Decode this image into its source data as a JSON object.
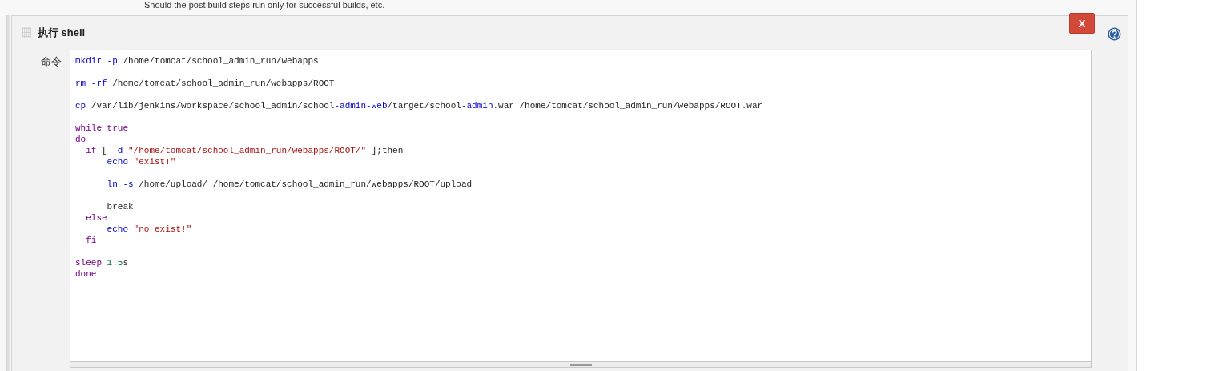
{
  "top_description": "Should the post build steps run only for successful builds, etc.",
  "section": {
    "title": "执行 shell",
    "delete_label": "X",
    "field_label": "命令",
    "code_lines": [
      {
        "kind": "code",
        "tokens": [
          {
            "text": "mkdir",
            "kind": "builtin"
          },
          {
            "text": " -p",
            "kind": "builtin"
          },
          {
            "text": " /home/tomcat/school_admin_run/webapps",
            "kind": "plain"
          }
        ]
      },
      {
        "kind": "blank"
      },
      {
        "kind": "code",
        "tokens": [
          {
            "text": "rm",
            "kind": "builtin"
          },
          {
            "text": " -rf",
            "kind": "builtin"
          },
          {
            "text": " /home/tomcat/school_admin_run/webapps/ROOT",
            "kind": "plain"
          }
        ]
      },
      {
        "kind": "blank"
      },
      {
        "kind": "code",
        "tokens": [
          {
            "text": "cp",
            "kind": "builtin"
          },
          {
            "text": " /var/lib/jenkins/workspace/school_admin/school",
            "kind": "plain"
          },
          {
            "text": "-admin-web",
            "kind": "builtin"
          },
          {
            "text": "/target/school",
            "kind": "plain"
          },
          {
            "text": "-admin",
            "kind": "builtin"
          },
          {
            "text": ".war /home/tomcat/school_admin_run/webapps/ROOT.war",
            "kind": "plain"
          }
        ]
      },
      {
        "kind": "blank"
      },
      {
        "kind": "code",
        "tokens": [
          {
            "text": "while",
            "kind": "keyword"
          },
          {
            "text": " true",
            "kind": "keyword"
          }
        ]
      },
      {
        "kind": "code",
        "tokens": [
          {
            "text": "do",
            "kind": "keyword"
          }
        ]
      },
      {
        "kind": "code",
        "tokens": [
          {
            "text": "  if",
            "kind": "keyword"
          },
          {
            "text": " [",
            "kind": "plain"
          },
          {
            "text": " -d",
            "kind": "builtin"
          },
          {
            "text": " \"/home/tomcat/school_admin_run/webapps/ROOT/\"",
            "kind": "string"
          },
          {
            "text": " ];then",
            "kind": "plain"
          }
        ]
      },
      {
        "kind": "code",
        "tokens": [
          {
            "text": "      echo",
            "kind": "builtin"
          },
          {
            "text": " \"exist!\"",
            "kind": "string"
          }
        ]
      },
      {
        "kind": "blank"
      },
      {
        "kind": "code",
        "tokens": [
          {
            "text": "      ln -s",
            "kind": "builtin"
          },
          {
            "text": " /home/upload/ /home/tomcat/school_admin_run/webapps/ROOT/upload",
            "kind": "plain"
          }
        ]
      },
      {
        "kind": "blank"
      },
      {
        "kind": "code",
        "tokens": [
          {
            "text": "      break",
            "kind": "plain"
          }
        ]
      },
      {
        "kind": "code",
        "tokens": [
          {
            "text": "  else",
            "kind": "keyword"
          }
        ]
      },
      {
        "kind": "code",
        "tokens": [
          {
            "text": "      echo",
            "kind": "builtin"
          },
          {
            "text": " \"no exist!\"",
            "kind": "string"
          }
        ]
      },
      {
        "kind": "code",
        "tokens": [
          {
            "text": "  fi",
            "kind": "keyword"
          }
        ]
      },
      {
        "kind": "blank"
      },
      {
        "kind": "code",
        "tokens": [
          {
            "text": "sleep",
            "kind": "keyword"
          },
          {
            "text": " 1.5",
            "kind": "number"
          },
          {
            "text": "s",
            "kind": "plain"
          }
        ]
      },
      {
        "kind": "code",
        "tokens": [
          {
            "text": "done",
            "kind": "keyword"
          }
        ]
      }
    ]
  }
}
